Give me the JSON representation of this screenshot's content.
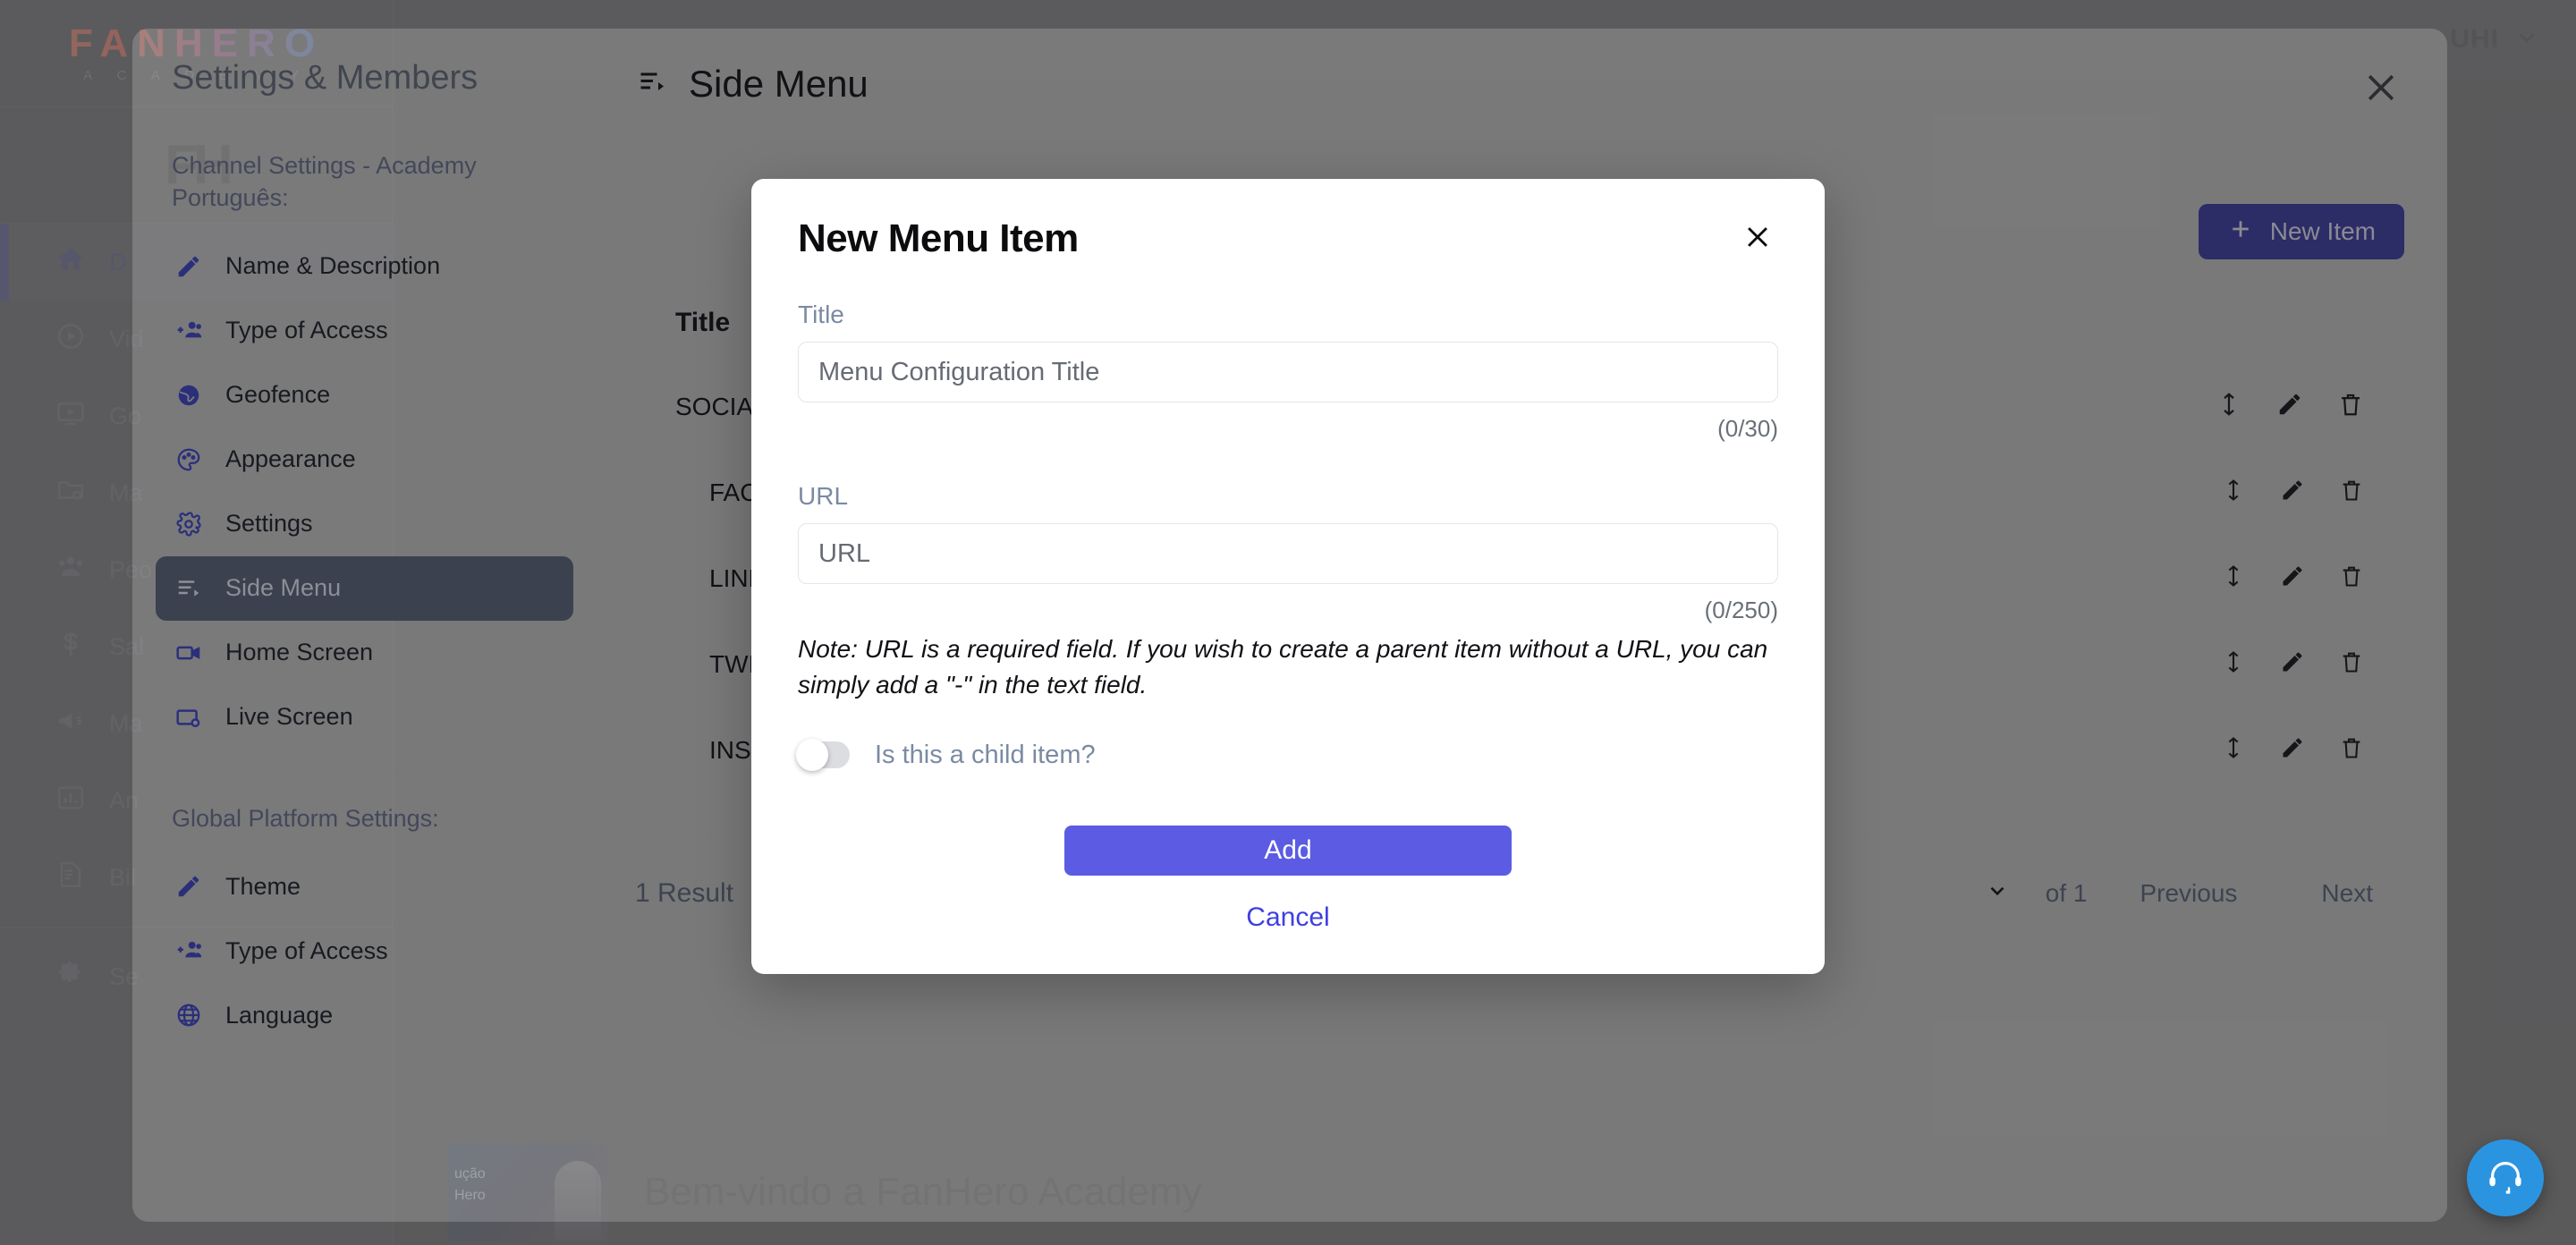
{
  "app": {
    "brand": {
      "name": "FANHERO",
      "subtitle": "A C A D E M Y",
      "mark": "FH"
    },
    "user_menu": {
      "label": "UHI"
    },
    "nav": [
      {
        "label": "D",
        "icon": "home-icon",
        "active": true
      },
      {
        "label": "Vid",
        "icon": "play-circle-icon",
        "active": false
      },
      {
        "label": "Go",
        "icon": "tv-play-icon",
        "active": false
      },
      {
        "label": "Ma",
        "icon": "folder-gear-icon",
        "active": false
      },
      {
        "label": "Peo",
        "icon": "people-icon",
        "active": false
      },
      {
        "label": "Sal",
        "icon": "dollar-icon",
        "active": false
      },
      {
        "label": "Ma",
        "icon": "megaphone-icon",
        "active": false
      },
      {
        "label": "An",
        "icon": "bar-chart-icon",
        "active": false
      },
      {
        "label": "Bil",
        "icon": "invoice-icon",
        "active": false
      },
      {
        "label": "Se",
        "icon": "gear-icon",
        "active": false
      }
    ],
    "hero": {
      "title": "Bem-vindo a FanHero Academy",
      "thumb_line1": "ução",
      "thumb_line2": "Hero"
    }
  },
  "panel": {
    "title": "Settings & Members",
    "channel_group_label": "Channel Settings - Academy Português:",
    "global_group_label": "Global Platform Settings:",
    "channel_items": [
      {
        "label": "Name & Description",
        "icon": "pencil-icon",
        "active": false
      },
      {
        "label": "Type of Access",
        "icon": "add-person-icon",
        "active": false
      },
      {
        "label": "Geofence",
        "icon": "globe-filled-icon",
        "active": false
      },
      {
        "label": "Appearance",
        "icon": "palette-icon",
        "active": false
      },
      {
        "label": "Settings",
        "icon": "gear-icon",
        "active": false
      },
      {
        "label": "Side Menu",
        "icon": "side-menu-icon",
        "active": true
      },
      {
        "label": "Home Screen",
        "icon": "video-camera-icon",
        "active": false
      },
      {
        "label": "Live Screen",
        "icon": "live-screen-icon",
        "active": false
      }
    ],
    "global_items": [
      {
        "label": "Theme",
        "icon": "pencil-icon",
        "active": false
      },
      {
        "label": "Type of Access",
        "icon": "add-person-icon",
        "active": false
      },
      {
        "label": "Language",
        "icon": "globe-outline-icon",
        "active": false
      }
    ],
    "content": {
      "heading": "Side Menu",
      "new_item_label": "New Item",
      "close_label": "Close",
      "table": {
        "columns": [
          "Title"
        ],
        "rows": [
          {
            "title": "SOCIA",
            "indent": false
          },
          {
            "title": "FAC",
            "indent": true
          },
          {
            "title": "LINK",
            "indent": true
          },
          {
            "title": "TWI",
            "indent": true
          },
          {
            "title": "INST",
            "indent": true
          }
        ]
      },
      "footer": {
        "result_count": "1 Result",
        "page_value": "",
        "of_label": "of 1",
        "previous_label": "Previous",
        "next_label": "Next"
      }
    }
  },
  "modal": {
    "title": "New Menu Item",
    "close_label": "Close",
    "title_field": {
      "label": "Title",
      "value": "",
      "placeholder": "Menu Configuration Title",
      "counter": "(0/30)"
    },
    "url_field": {
      "label": "URL",
      "value": "",
      "placeholder": "URL",
      "counter": "(0/250)"
    },
    "note": "Note: URL is a required field. If you wish to create a parent item without a URL, you can simply add a \"-\" in the text field.",
    "toggle": {
      "label": "Is this a child item?",
      "checked": false
    },
    "add_label": "Add",
    "cancel_label": "Cancel"
  },
  "support": {
    "label": "Support",
    "color": "#2b94e0"
  },
  "colors": {
    "accent": "#5b5be3",
    "link": "#3f3fe0",
    "new_item_bg": "#2c2c66",
    "label_blue": "#7b8aa3",
    "sidebar_active_bg": "#3b414e"
  }
}
